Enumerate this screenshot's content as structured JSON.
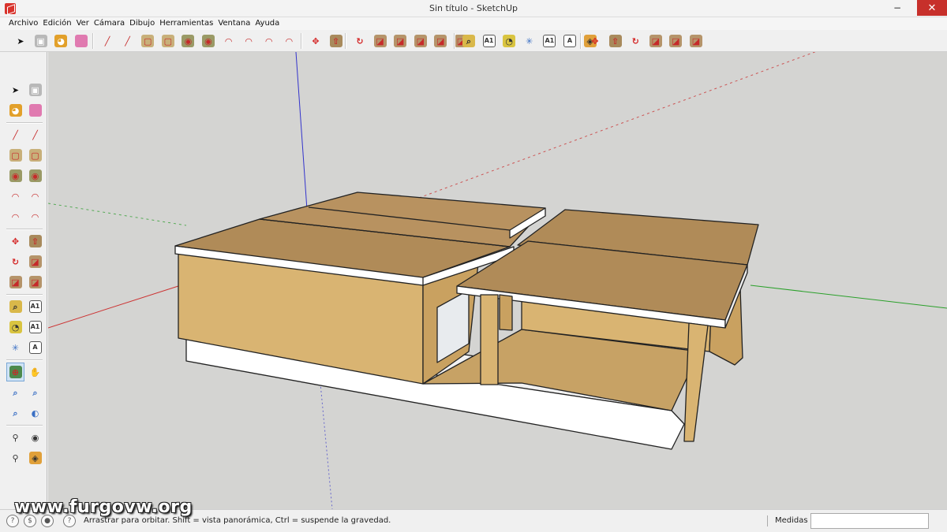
{
  "window": {
    "title": "Sin título - SketchUp",
    "controls": {
      "minimize": "−",
      "maximize": "□",
      "close": "✕"
    }
  },
  "menu": [
    "Archivo",
    "Edición",
    "Ver",
    "Cámara",
    "Dibujo",
    "Herramientas",
    "Ventana",
    "Ayuda"
  ],
  "toolbar_top": {
    "groups": [
      [
        "select-icon",
        "component-icon",
        "paint-bucket-icon",
        "eraser-icon"
      ],
      [
        "line-icon",
        "freehand-icon",
        "rectangle-icon",
        "rotated-rectangle-icon",
        "circle-icon",
        "polygon-icon",
        "arc-icon",
        "two-point-arc-icon",
        "three-point-arc-icon",
        "pie-icon"
      ],
      [
        "move-icon",
        "push-pull-icon"
      ],
      [
        "rotate-icon",
        "follow-me-icon",
        "scale-icon",
        "offset-icon",
        "flip-icon",
        "intersect-icon"
      ],
      [
        "tape-measure-icon",
        "dimension-icon",
        "protractor-icon",
        "axes-icon",
        "text-icon",
        "3d-text-icon",
        "section-plane-icon"
      ],
      [
        "move-tool-icon",
        "push-pull-tool-icon",
        "rotate-tool-icon",
        "follow-me-tool-icon",
        "scale-tool-icon",
        "offset-tool-icon"
      ]
    ]
  },
  "toolbar_left": {
    "rows": [
      [
        "select-icon",
        "component-icon"
      ],
      [
        "paint-bucket-icon",
        "eraser-icon"
      ],
      [
        "line-icon",
        "freehand-icon"
      ],
      [
        "rectangle-icon",
        "rotated-rectangle-icon"
      ],
      [
        "circle-icon",
        "polygon-icon"
      ],
      [
        "arc-icon",
        "two-point-arc-icon"
      ],
      [
        "three-point-arc-icon",
        "pie-icon"
      ],
      [
        "move-icon",
        "push-pull-icon"
      ],
      [
        "rotate-icon",
        "follow-me-icon"
      ],
      [
        "scale-icon",
        "offset-icon"
      ],
      [
        "tape-measure-icon",
        "dimension-icon"
      ],
      [
        "protractor-icon",
        "text-icon"
      ],
      [
        "axes-icon",
        "3d-text-icon"
      ],
      [
        "orbit-icon",
        "pan-icon"
      ],
      [
        "zoom-icon",
        "zoom-window-icon"
      ],
      [
        "zoom-extents-icon",
        "previous-view-icon"
      ],
      [
        "position-camera-icon",
        "look-around-icon"
      ],
      [
        "walk-icon",
        "section-plane-icon"
      ]
    ],
    "selected": "orbit-icon"
  },
  "text_glyphs": {
    "text-icon": "A1",
    "dimension-icon": "A1"
  },
  "status": {
    "watermark": "www.furgovw.org",
    "message": "Arrastrar para orbitar. Shift = vista panorámica, Ctrl = suspende la gravedad.",
    "measurements_label": "Medidas",
    "measurements_value": ""
  },
  "colors": {
    "viewport_bg": "#d4d4d2",
    "wood_top": "#b08b58",
    "wood_side": "#d9b472",
    "edge": "#222222",
    "axis_red": "#cc3333",
    "axis_green": "#2aa02a",
    "axis_blue": "#3333cc"
  }
}
